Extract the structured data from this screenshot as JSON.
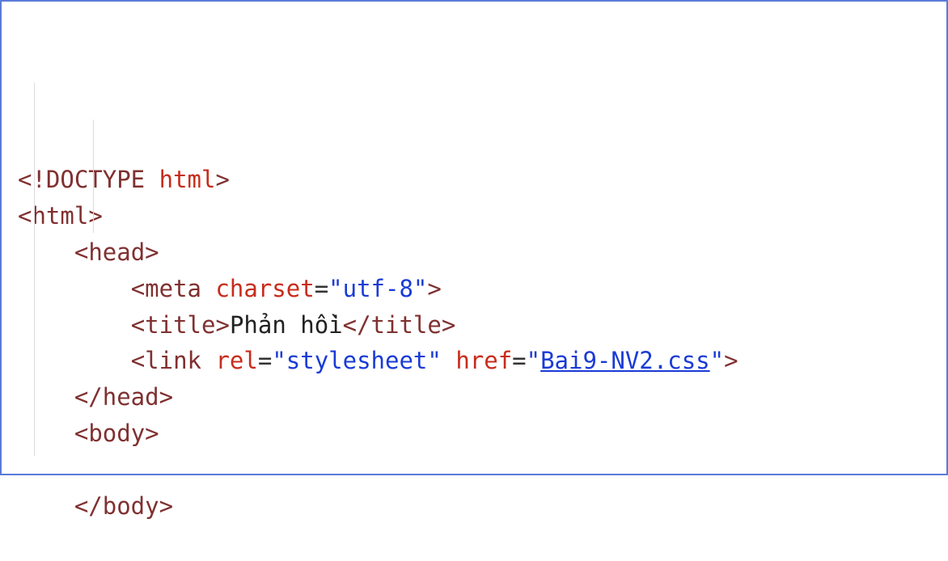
{
  "code": {
    "lines": [
      {
        "indent": 0,
        "tokens": [
          {
            "t": "<!",
            "c": "br"
          },
          {
            "t": "DOCTYPE ",
            "c": "doctype"
          },
          {
            "t": "html",
            "c": "kw"
          },
          {
            "t": ">",
            "c": "br"
          }
        ]
      },
      {
        "indent": 0,
        "tokens": [
          {
            "t": "<",
            "c": "br"
          },
          {
            "t": "html",
            "c": "tag"
          },
          {
            "t": ">",
            "c": "br"
          }
        ]
      },
      {
        "indent": 1,
        "tokens": [
          {
            "t": "<",
            "c": "br"
          },
          {
            "t": "head",
            "c": "tag"
          },
          {
            "t": ">",
            "c": "br"
          }
        ]
      },
      {
        "indent": 2,
        "tokens": [
          {
            "t": "<",
            "c": "br"
          },
          {
            "t": "meta ",
            "c": "tag"
          },
          {
            "t": "charset",
            "c": "attr"
          },
          {
            "t": "=",
            "c": "eq"
          },
          {
            "t": "\"utf-8\"",
            "c": "str"
          },
          {
            "t": ">",
            "c": "br"
          }
        ]
      },
      {
        "indent": 2,
        "tokens": [
          {
            "t": "<",
            "c": "br"
          },
          {
            "t": "title",
            "c": "tag"
          },
          {
            "t": ">",
            "c": "br"
          },
          {
            "t": "Phản hồi",
            "c": "txt"
          },
          {
            "t": "</",
            "c": "br"
          },
          {
            "t": "title",
            "c": "tag"
          },
          {
            "t": ">",
            "c": "br"
          }
        ]
      },
      {
        "indent": 2,
        "tokens": [
          {
            "t": "<",
            "c": "br"
          },
          {
            "t": "link ",
            "c": "tag"
          },
          {
            "t": "rel",
            "c": "attr"
          },
          {
            "t": "=",
            "c": "eq"
          },
          {
            "t": "\"stylesheet\"",
            "c": "str"
          },
          {
            "t": " ",
            "c": "txt"
          },
          {
            "t": "href",
            "c": "attr"
          },
          {
            "t": "=",
            "c": "eq"
          },
          {
            "t": "\"",
            "c": "str"
          },
          {
            "t": "Bai9-NV2.css",
            "c": "link-val"
          },
          {
            "t": "\"",
            "c": "str"
          },
          {
            "t": ">",
            "c": "br"
          }
        ]
      },
      {
        "indent": 1,
        "tokens": [
          {
            "t": "</",
            "c": "br"
          },
          {
            "t": "head",
            "c": "tag"
          },
          {
            "t": ">",
            "c": "br"
          }
        ]
      },
      {
        "indent": 1,
        "tokens": [
          {
            "t": "<",
            "c": "br"
          },
          {
            "t": "body",
            "c": "tag"
          },
          {
            "t": ">",
            "c": "br"
          }
        ]
      },
      {
        "indent": 1,
        "tokens": [
          {
            "t": "",
            "c": "txt"
          }
        ]
      },
      {
        "indent": 1,
        "tokens": [
          {
            "t": "</",
            "c": "br"
          },
          {
            "t": "body",
            "c": "tag"
          },
          {
            "t": ">",
            "c": "br"
          }
        ]
      }
    ],
    "indent_unit": "    "
  }
}
